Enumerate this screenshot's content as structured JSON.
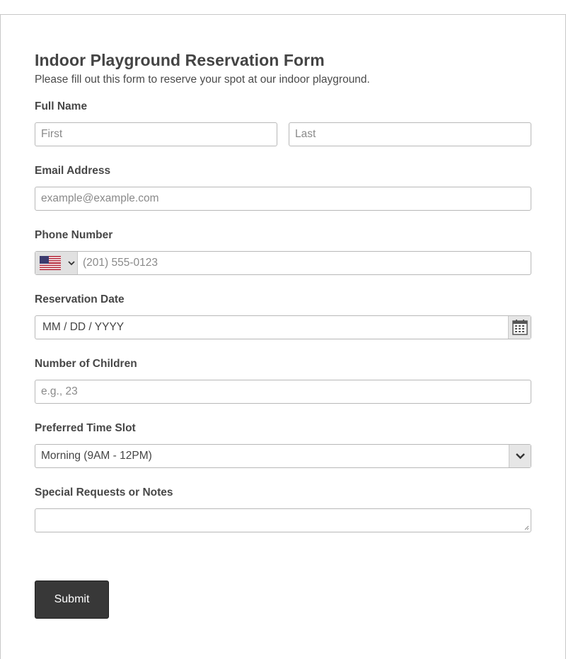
{
  "form": {
    "title": "Indoor Playground Reservation Form",
    "subtitle": "Please fill out this form to reserve your spot at our indoor playground."
  },
  "full_name": {
    "label": "Full Name",
    "first_placeholder": "First",
    "last_placeholder": "Last"
  },
  "email": {
    "label": "Email Address",
    "placeholder": "example@example.com"
  },
  "phone": {
    "label": "Phone Number",
    "country_icon": "us-flag-icon",
    "placeholder": "(201) 555-0123"
  },
  "reservation_date": {
    "label": "Reservation Date",
    "placeholder": "MM / DD / YYYY",
    "icon": "calendar-icon"
  },
  "children": {
    "label": "Number of Children",
    "placeholder": "e.g., 23"
  },
  "time_slot": {
    "label": "Preferred Time Slot",
    "selected": "Morning (9AM - 12PM)",
    "icon": "chevron-down-icon"
  },
  "notes": {
    "label": "Special Requests or Notes",
    "value": ""
  },
  "submit": {
    "label": "Submit"
  },
  "colors": {
    "button_bg": "#383838",
    "border": "#b8b8b8",
    "text": "#404040"
  }
}
